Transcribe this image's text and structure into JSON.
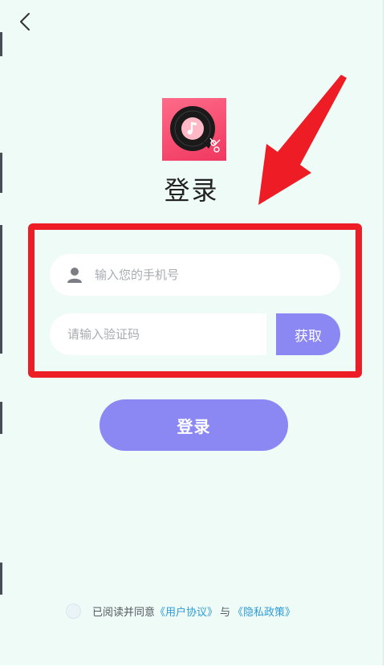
{
  "nav": {
    "back_icon": "chevron-left-icon"
  },
  "logo": {
    "icon": "music-record-scissors-icon",
    "colors": {
      "bg": "#f0375f",
      "disc": "#1a1a1a",
      "label": "#ffb8c6"
    }
  },
  "page": {
    "title": "登录"
  },
  "form": {
    "phone": {
      "icon": "user-icon",
      "placeholder": "输入您的手机号",
      "value": ""
    },
    "code": {
      "placeholder": "请输入验证码",
      "value": ""
    },
    "get_code_label": "获取",
    "login_label": "登录"
  },
  "agreement": {
    "prefix": "已阅读并同意",
    "user_agreement": "《用户协议》",
    "connector": "与",
    "privacy_policy": "《隐私政策》",
    "checked": false
  },
  "annotation": {
    "arrow_color": "#ee1c25",
    "box_color": "#ee1c25"
  },
  "colors": {
    "background": "#eefbf7",
    "accent": "#8b88f4",
    "link": "#2f9bd8"
  }
}
